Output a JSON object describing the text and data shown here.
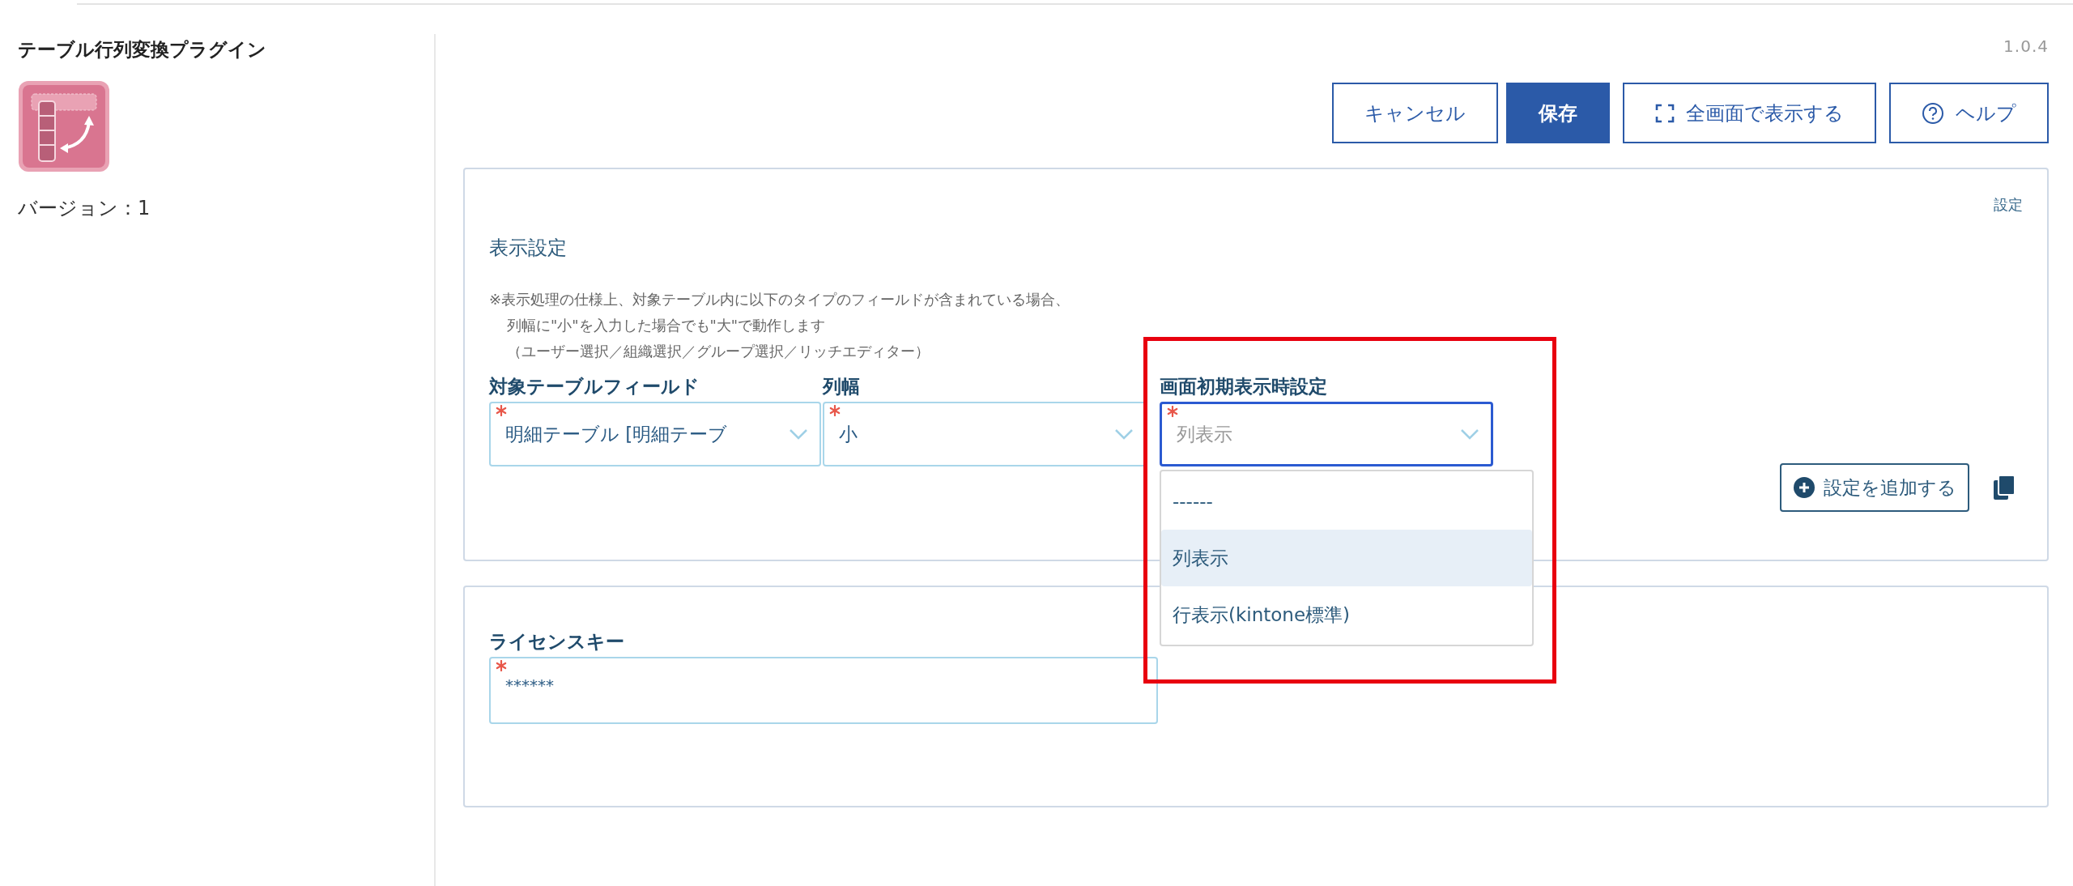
{
  "plugin": {
    "title": "テーブル行列変換プラグイン",
    "version_label": "バージョン：1"
  },
  "app_version": "1.0.4",
  "buttons": [
    {
      "label": "キャンセル",
      "kind": "plain"
    },
    {
      "label": "保存",
      "kind": "primary"
    },
    {
      "label": "全画面で表示する",
      "kind": "fullscreen"
    },
    {
      "label": "ヘルプ",
      "kind": "help"
    }
  ],
  "settings_panel": {
    "corner_label": "設定",
    "section_title": "表示設定",
    "notes": [
      "※表示処理の仕様上、対象テーブル内に以下のタイプのフィールドが含まれている場合、",
      "列幅に\"小\"を入力した場合でも\"大\"で動作します",
      "（ユーザー選択／組織選択／グループ選択／リッチエディター）"
    ],
    "fields": [
      {
        "label": "対象テーブルフィールド",
        "value": "明細テーブル [明細テーブ",
        "required": true,
        "focused": false
      },
      {
        "label": "列幅",
        "value": "小",
        "required": true,
        "focused": false
      },
      {
        "label": "画面初期表示時設定",
        "value": "列表示",
        "required": true,
        "focused": true
      }
    ],
    "dropdown": {
      "options": [
        {
          "label": "------",
          "selected": false
        },
        {
          "label": "列表示",
          "selected": true
        },
        {
          "label": "行表示(kintone標準)",
          "selected": false
        }
      ]
    },
    "add_button": "設定を追加する"
  },
  "license": {
    "label": "ライセンスキー",
    "value": "******",
    "required": true
  }
}
